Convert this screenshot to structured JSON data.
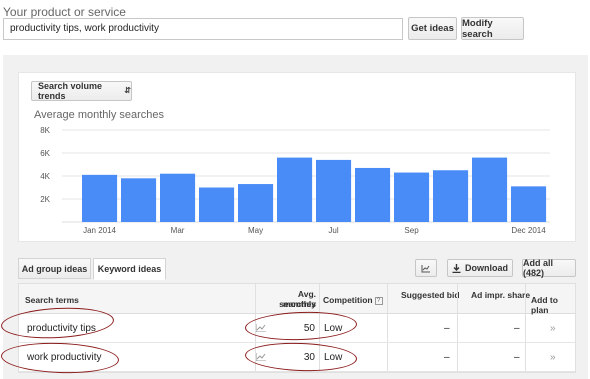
{
  "header": {
    "label": "Your product or service",
    "search_value": "productivity tips, work productivity",
    "get_ideas": "Get ideas",
    "modify_search": "Modify search"
  },
  "trend_selector": {
    "label": "Search volume trends"
  },
  "chart_data": {
    "type": "bar",
    "title": "Average monthly searches",
    "xlabel": "",
    "ylabel": "",
    "ylim": [
      0,
      8000
    ],
    "yticks": [
      "2K",
      "4K",
      "6K",
      "8K"
    ],
    "x_tick_labels": [
      "Jan 2014",
      "Mar",
      "May",
      "Jul",
      "Sep",
      "Dec 2014"
    ],
    "categories": [
      "Jan 2014",
      "Feb",
      "Mar",
      "Apr",
      "May",
      "Jun",
      "Jul",
      "Aug",
      "Sep",
      "Oct",
      "Nov",
      "Dec 2014"
    ],
    "values": [
      4100,
      3800,
      4200,
      3000,
      3300,
      5600,
      5400,
      4700,
      4300,
      4500,
      5600,
      3100
    ],
    "bar_color": "#4a8cf7"
  },
  "tabs": [
    {
      "label": "Ad group ideas"
    },
    {
      "label": "Keyword ideas"
    }
  ],
  "toolbar": {
    "download": "Download",
    "add_all": "Add all (482)"
  },
  "table": {
    "headers": {
      "search_terms": "Search terms",
      "avg_monthly_line1": "Avg. monthly",
      "avg_monthly_line2": "searches",
      "competition": "Competition",
      "suggested_bid": "Suggested bid",
      "ad_impr_share": "Ad impr. share",
      "add_to_plan": "Add to plan"
    },
    "rows": [
      {
        "term": "productivity tips",
        "avg": "50",
        "competition": "Low",
        "bid": "–",
        "share": "–",
        "add": "»"
      },
      {
        "term": "work productivity",
        "avg": "30",
        "competition": "Low",
        "bid": "–",
        "share": "–",
        "add": "»"
      }
    ]
  },
  "colors": {
    "accent": "#4a8cf7",
    "annotation": "#8b1c1c"
  }
}
